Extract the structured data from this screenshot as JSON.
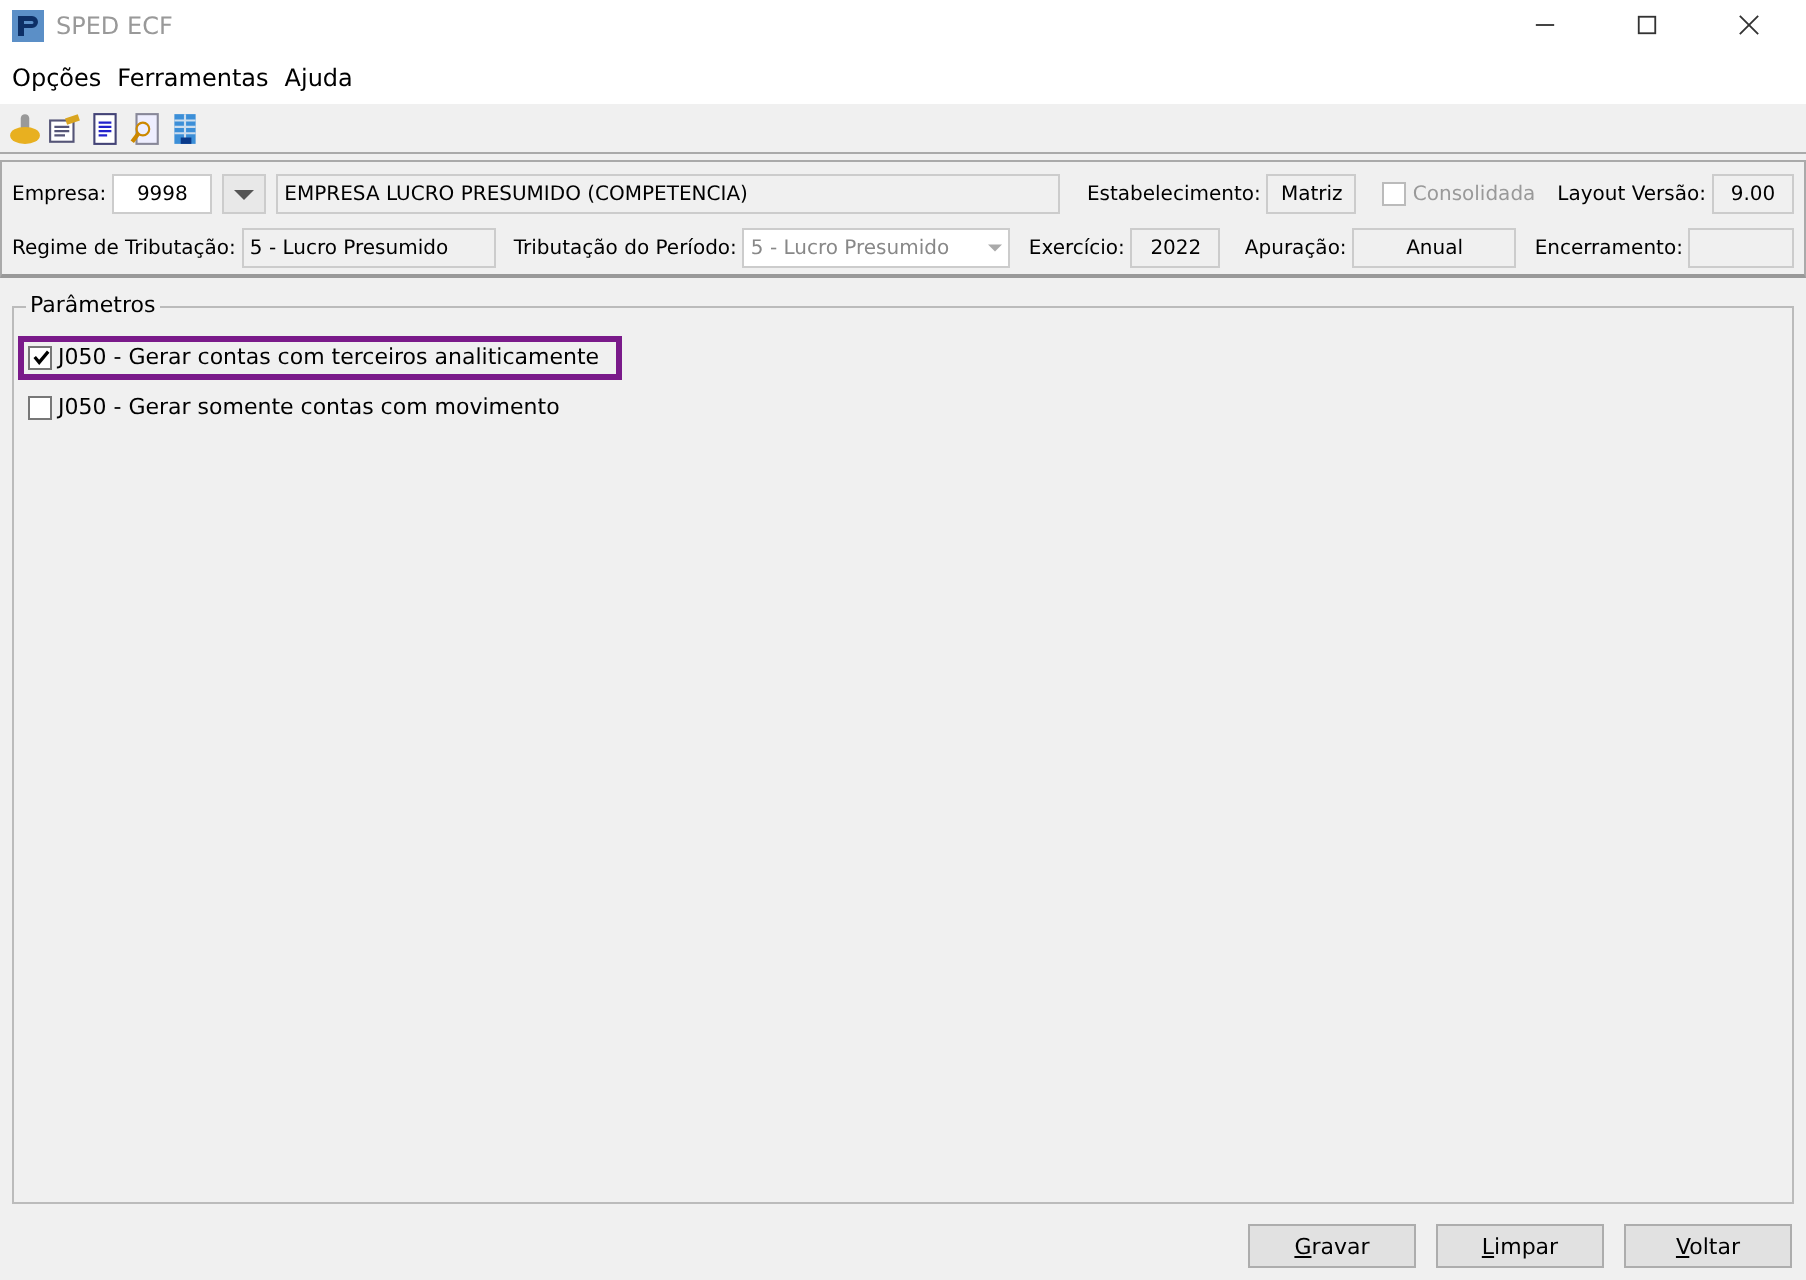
{
  "window": {
    "title": "SPED ECF"
  },
  "menu": [
    "Opções",
    "Ferramentas",
    "Ajuda"
  ],
  "header": {
    "empresa_label": "Empresa:",
    "empresa_code": "9998",
    "empresa_name": "EMPRESA LUCRO PRESUMIDO (COMPETENCIA)",
    "estabelecimento_label": "Estabelecimento:",
    "estabelecimento": "Matriz",
    "consolidada": {
      "label": "Consolidada",
      "checked": false,
      "disabled": true
    },
    "layout_label": "Layout Versão:",
    "layout": "9.00",
    "regime_label": "Regime de Tributação:",
    "regime": "5 - Lucro Presumido",
    "periodo_label": "Tributação do Período:",
    "periodo": "5 - Lucro Presumido",
    "exercicio_label": "Exercício:",
    "exercicio": "2022",
    "apuracao_label": "Apuração:",
    "apuracao": "Anual",
    "encerramento_label": "Encerramento:"
  },
  "parametros": {
    "title": "Parâmetros",
    "options": [
      {
        "label": "J050 - Gerar contas com terceiros analiticamente",
        "checked": true,
        "highlighted": true
      },
      {
        "label": "J050 - Gerar somente contas com movimento",
        "checked": false,
        "highlighted": false
      }
    ]
  },
  "buttons": [
    "Gravar",
    "Limpar",
    "Voltar"
  ]
}
